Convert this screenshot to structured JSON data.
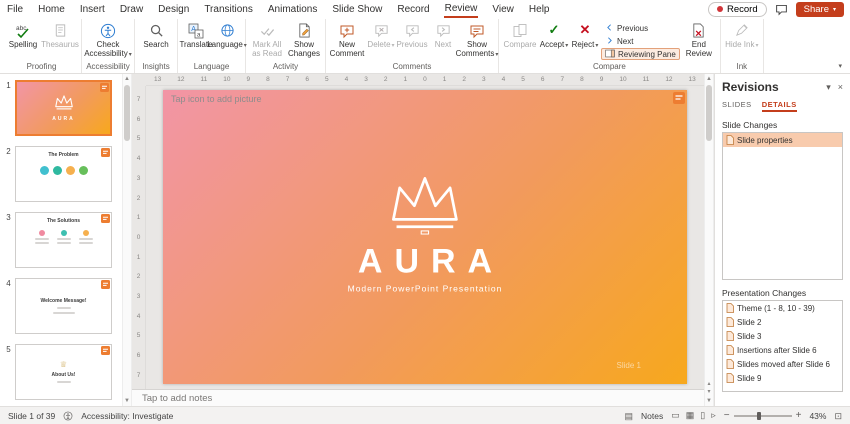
{
  "colors": {
    "accent": "#C43E1C",
    "selection": "#ED7D31",
    "highlight": "#F8CBAD",
    "grad1": "#F295A6",
    "grad2": "#F29A5E",
    "grad3": "#F7A81D"
  },
  "menubar": {
    "items": [
      "File",
      "Home",
      "Insert",
      "Draw",
      "Design",
      "Transitions",
      "Animations",
      "Slide Show",
      "Record",
      "Review",
      "View",
      "Help"
    ],
    "record": "Record",
    "share": "Share"
  },
  "ribbon": {
    "proofing": {
      "label": "Proofing",
      "spelling": "Spelling",
      "thesaurus": "Thesaurus"
    },
    "accessibility": {
      "label": "Accessibility",
      "check": "Check Accessibility"
    },
    "insights": {
      "label": "Insights",
      "search": "Search"
    },
    "language": {
      "label": "Language",
      "translate": "Translate",
      "language": "Language"
    },
    "activity": {
      "label": "Activity",
      "mark_all": "Mark All as Read",
      "show_changes": "Show Changes"
    },
    "comments": {
      "label": "Comments",
      "new_comment": "New Comment",
      "delete": "Delete",
      "previous": "Previous",
      "next": "Next",
      "show_comments": "Show Comments"
    },
    "compare": {
      "label": "Compare",
      "compare": "Compare",
      "accept": "Accept",
      "reject": "Reject",
      "previous": "Previous",
      "next": "Next",
      "reviewing_pane": "Reviewing Pane",
      "end_review": "End Review"
    },
    "ink": {
      "label": "Ink",
      "hide_ink": "Hide Ink"
    }
  },
  "thumbnails": [
    {
      "number": "1",
      "title": "AURA"
    },
    {
      "number": "2",
      "title": "The Problem"
    },
    {
      "number": "3",
      "title": "The Solutions"
    },
    {
      "number": "4",
      "title": "Welcome Message!"
    },
    {
      "number": "5",
      "title": "About Us!"
    }
  ],
  "rulers": {
    "horizontal": [
      "13",
      "12",
      "11",
      "10",
      "9",
      "8",
      "7",
      "6",
      "5",
      "4",
      "3",
      "2",
      "1",
      "0",
      "1",
      "2",
      "3",
      "4",
      "5",
      "6",
      "7",
      "8",
      "9",
      "10",
      "11",
      "12",
      "13"
    ],
    "vertical": [
      "7",
      "6",
      "5",
      "4",
      "3",
      "2",
      "1",
      "0",
      "1",
      "2",
      "3",
      "4",
      "5",
      "6",
      "7"
    ]
  },
  "slide": {
    "placeholder": "Tap icon to add picture",
    "title": "AURA",
    "subtitle": "Modern PowerPoint Presentation",
    "watermark": "Slide 1"
  },
  "notes": {
    "placeholder": "Tap to add notes"
  },
  "revisions": {
    "title": "Revisions",
    "tabs": {
      "slides": "SLIDES",
      "details": "DETAILS"
    },
    "slide_changes_label": "Slide Changes",
    "slide_changes": [
      "Slide properties"
    ],
    "presentation_changes_label": "Presentation Changes",
    "presentation_changes": [
      "Theme (1 - 8, 10 - 39)",
      "Slide 2",
      "Slide 3",
      "Insertions after Slide 6",
      "Slides moved after Slide 6",
      "Slide 9"
    ]
  },
  "statusbar": {
    "slide_info": "Slide 1 of 39",
    "accessibility": "Accessibility: Investigate",
    "notes": "Notes",
    "zoom": "43%"
  }
}
